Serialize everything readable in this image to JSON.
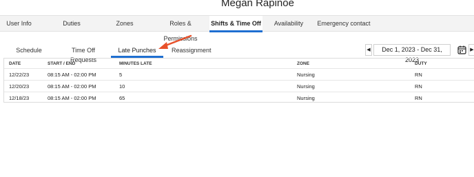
{
  "page": {
    "title": "Megan Rapinoe"
  },
  "top_tabs": [
    {
      "label": "User Info",
      "active": false
    },
    {
      "label": "Duties",
      "active": false
    },
    {
      "label": "Zones",
      "active": false
    },
    {
      "label": "Roles & Permissions",
      "active": false
    },
    {
      "label": "Shifts & Time Off",
      "active": true
    },
    {
      "label": "Availability",
      "active": false
    },
    {
      "label": "Emergency contact",
      "active": false
    }
  ],
  "sub_tabs": [
    {
      "label": "Schedule",
      "active": false
    },
    {
      "label": "Time Off Requests",
      "active": false
    },
    {
      "label": "Late Punches",
      "active": true
    },
    {
      "label": "Reassignment",
      "active": false
    }
  ],
  "date_range": {
    "label": "Dec 1, 2023 - Dec 31, 2023",
    "prev_icon": "caret-left-icon",
    "next_icon": "caret-right-icon",
    "calendar_icon": "calendar-icon"
  },
  "annotation": {
    "color": "#e8512a",
    "icon": "red-arrow-icon"
  },
  "accent_color": "#1f6fd1",
  "table": {
    "columns": [
      "DATE",
      "START / END",
      "MINUTES LATE",
      "ZONE",
      "DUTY"
    ],
    "rows": [
      [
        "12/22/23",
        "08:15 AM - 02:00 PM",
        "5",
        "Nursing",
        "RN"
      ],
      [
        "12/20/23",
        "08:15 AM - 02:00 PM",
        "10",
        "Nursing",
        "RN"
      ],
      [
        "12/18/23",
        "08:15 AM - 02:00 PM",
        "65",
        "Nursing",
        "RN"
      ]
    ]
  }
}
